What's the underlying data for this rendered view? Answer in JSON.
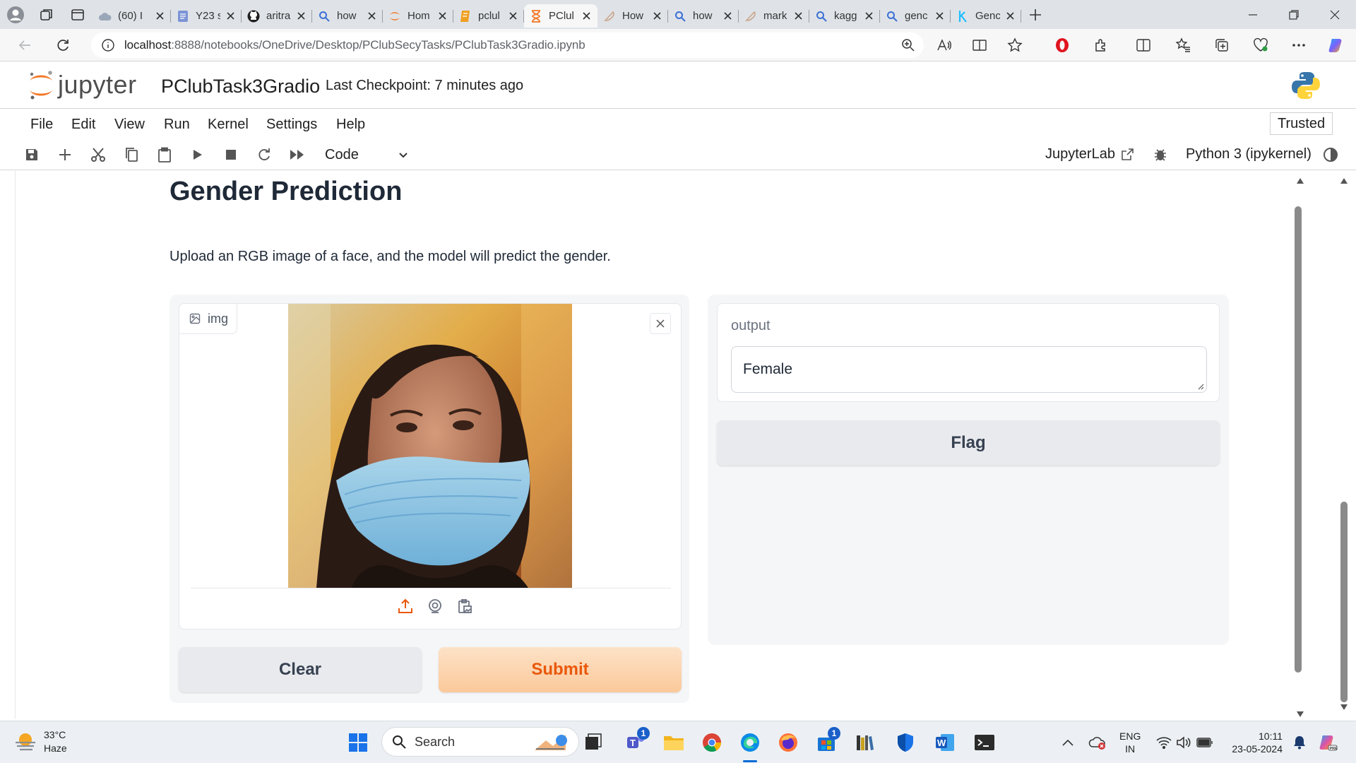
{
  "browser": {
    "tabs": [
      {
        "title": "(60) I",
        "icon": "cloud-icon"
      },
      {
        "title": "Y23 s",
        "icon": "doc-icon"
      },
      {
        "title": "aritra",
        "icon": "github-icon"
      },
      {
        "title": "how",
        "icon": "search-icon"
      },
      {
        "title": "Hom",
        "icon": "jupyter-icon"
      },
      {
        "title": "pclul",
        "icon": "notebook-icon"
      },
      {
        "title": "PClul",
        "icon": "hourglass-icon",
        "active": true
      },
      {
        "title": "How",
        "icon": "feather-icon"
      },
      {
        "title": "how",
        "icon": "search-icon"
      },
      {
        "title": "mark",
        "icon": "feather-icon"
      },
      {
        "title": "kagg",
        "icon": "search-icon"
      },
      {
        "title": "genc",
        "icon": "search-icon"
      },
      {
        "title": "Genc",
        "icon": "kaggle-icon"
      }
    ],
    "url_host": "localhost",
    "url_path": ":8888/notebooks/OneDrive/Desktop/PClubSecyTasks/PClubTask3Gradio.ipynb"
  },
  "jupyter": {
    "logo_text": "jupyter",
    "notebook_name": "PClubTask3Gradio",
    "checkpoint": "Last Checkpoint: 7 minutes ago",
    "menu": [
      "File",
      "Edit",
      "View",
      "Run",
      "Kernel",
      "Settings",
      "Help"
    ],
    "trusted": "Trusted",
    "cell_type": "Code",
    "jupyterlab_link": "JupyterLab",
    "kernel": "Python 3 (ipykernel)"
  },
  "gradio": {
    "title": "Gender Prediction",
    "description": "Upload an RGB image of a face, and the model will predict the gender.",
    "image_label": "img",
    "output_label": "output",
    "output_value": "Female",
    "clear_label": "Clear",
    "submit_label": "Submit",
    "flag_label": "Flag"
  },
  "taskbar": {
    "temperature": "33°C",
    "weather": "Haze",
    "search_placeholder": "Search",
    "teams_badge": "1",
    "store_badge": "1",
    "lang_1": "ENG",
    "lang_2": "IN",
    "time": "10:11",
    "date": "23-05-2024"
  },
  "colors": {
    "accent_orange": "#ea580c",
    "submit_bg": "#fbc99a",
    "tabbar_bg": "#dfe3e8"
  }
}
